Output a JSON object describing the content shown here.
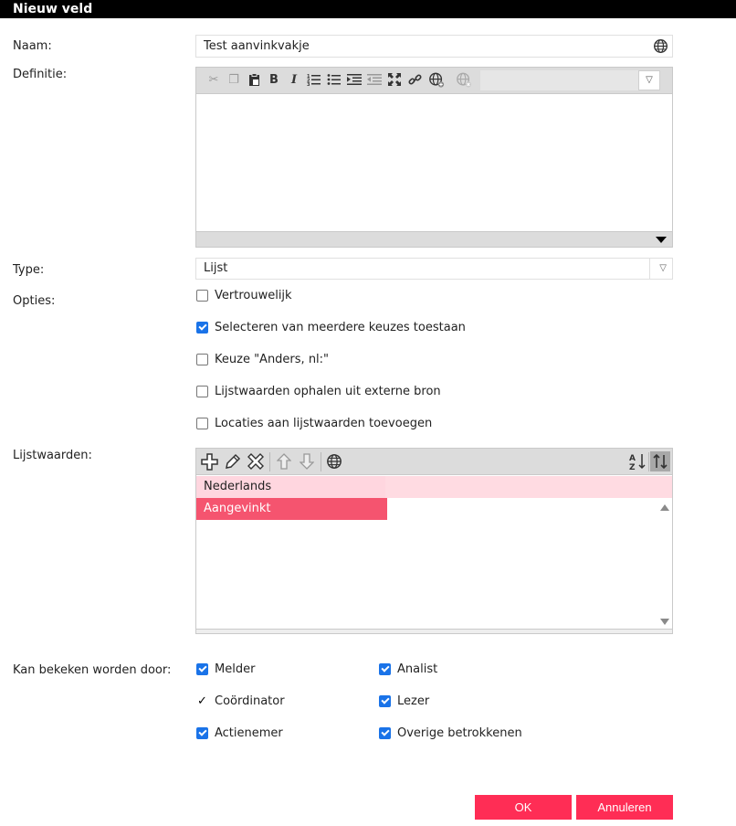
{
  "window": {
    "title": "Nieuw veld"
  },
  "form": {
    "name_label": "Naam:",
    "name_value": "Test aanvinkvakje",
    "definition_label": "Definitie:",
    "type_label": "Type:",
    "type_value": "Lijst",
    "options_label": "Opties:",
    "list_values_label": "Lijstwaarden:",
    "visible_by_label": "Kan bekeken worden door:"
  },
  "options": [
    {
      "label": "Vertrouwelijk",
      "checked": false
    },
    {
      "label": "Selecteren van meerdere keuzes toestaan",
      "checked": true
    },
    {
      "label": "Keuze \"Anders, nl:\"",
      "checked": false
    },
    {
      "label": "Lijstwaarden ophalen uit externe bron",
      "checked": false
    },
    {
      "label": "Locaties aan lijstwaarden toevoegen",
      "checked": false
    }
  ],
  "list_values": {
    "header": "Nederlands",
    "items": [
      {
        "label": "Aangevinkt",
        "selected": true
      }
    ]
  },
  "visible_by": [
    {
      "label": "Melder",
      "checked": true
    },
    {
      "label": "Analist",
      "checked": true
    },
    {
      "label": "Coördinator",
      "checked": true
    },
    {
      "label": "Lezer",
      "checked": true
    },
    {
      "label": "Actienemer",
      "checked": true
    },
    {
      "label": "Overige betrokkenen",
      "checked": true
    }
  ],
  "buttons": {
    "ok": "OK",
    "cancel": "Annuleren"
  },
  "colors": {
    "accent": "#ff2d55",
    "selected_row": "#f5546f",
    "header_row": "#ffd6df",
    "checkbox": "#1a73e8"
  }
}
